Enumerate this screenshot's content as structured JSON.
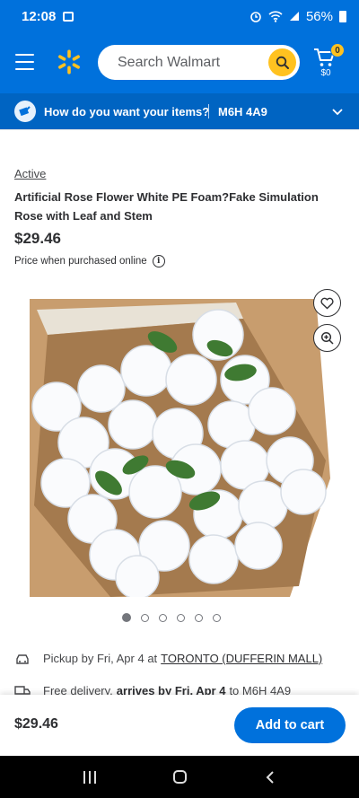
{
  "status_bar": {
    "time": "12:08",
    "battery": "56%"
  },
  "header": {
    "search_placeholder": "Search Walmart",
    "cart_count": "0",
    "cart_total": "$0"
  },
  "delivery_bar": {
    "question": "How do you want your items?",
    "separator": "|",
    "postal_code": "M6H 4A9"
  },
  "product": {
    "status": "Active",
    "title": "Artificial Rose Flower White PE Foam?Fake Simulation Rose with Leaf and Stem",
    "price": "$29.46",
    "price_note": "Price when purchased online",
    "image_count": 6,
    "active_image_index": 0
  },
  "fulfillment": {
    "pickup_prefix": "Pickup by Fri, Apr 4 at",
    "pickup_store": "TORONTO (DUFFERIN MALL)",
    "delivery_prefix": "Free delivery,",
    "delivery_bold": "arrives by Fri, Apr 4",
    "delivery_to": "to M6H 4A9"
  },
  "cart_bar": {
    "price": "$29.46",
    "add_to_cart_label": "Add to cart"
  },
  "colors": {
    "brand_blue": "#0071dc",
    "spark_yellow": "#ffc220"
  }
}
